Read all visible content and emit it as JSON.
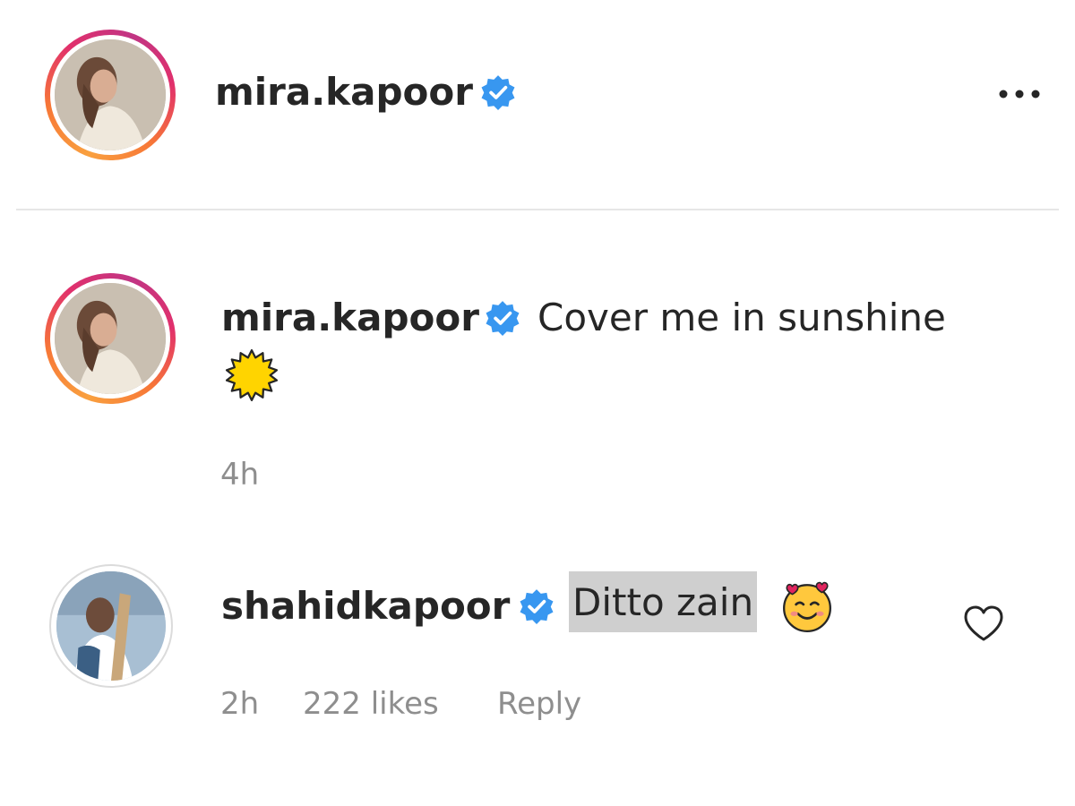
{
  "header": {
    "username": "mira.kapoor",
    "verified": true,
    "more_icon": "more-horizontal-icon"
  },
  "caption": {
    "username": "mira.kapoor",
    "verified": true,
    "text": "Cover me in sunshine",
    "emoji": "sun-emoji",
    "time": "4h"
  },
  "comment": {
    "username": "shahidkapoor",
    "verified": true,
    "text": "Ditto zain",
    "emoji": "smiling-face-with-hearts-emoji",
    "time": "2h",
    "likes": "222 likes",
    "reply_label": "Reply",
    "like_icon": "heart-outline-icon"
  },
  "colors": {
    "verified_blue": "#3897f0",
    "secondary_text": "#8e8e8e",
    "highlight": "#cfcfcf"
  }
}
